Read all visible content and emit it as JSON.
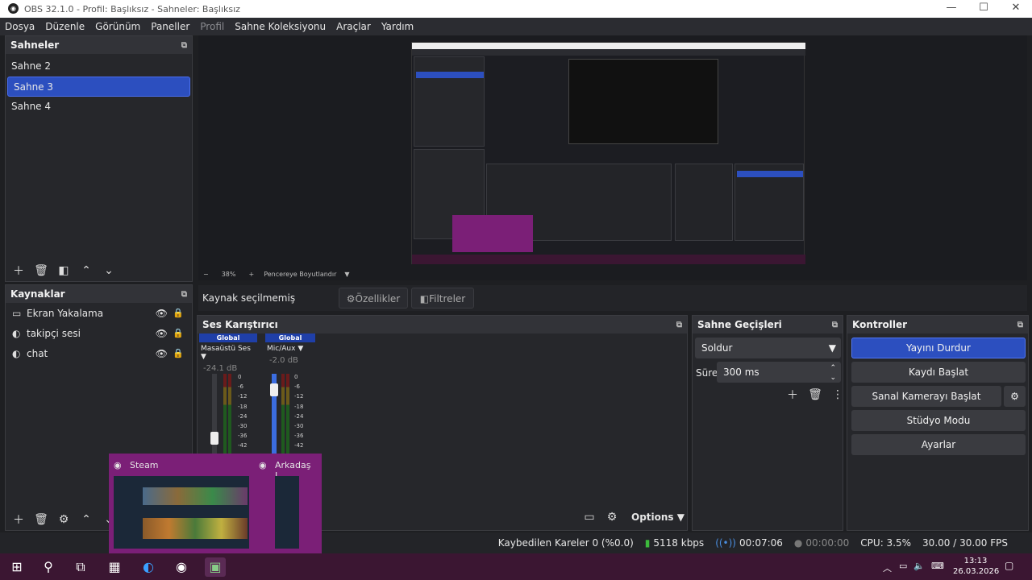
{
  "title": "OBS 32.1.0 - Profil: Başlıksız - Sahneler: Başlıksız",
  "menu": [
    "Dosya",
    "Düzenle",
    "Görünüm",
    "Paneller",
    "Profil",
    "Sahne Koleksiyonu",
    "Araçlar",
    "Yardım"
  ],
  "scenes": {
    "title": "Sahneler",
    "items": [
      "Sahne 2",
      "Sahne 3",
      "Sahne 4"
    ],
    "selected": 1
  },
  "sources": {
    "title": "Kaynaklar",
    "items": [
      {
        "label": "Ekran Yakalama",
        "icon": "monitor-icon"
      },
      {
        "label": "takipçi sesi",
        "icon": "browser-icon"
      },
      {
        "label": "chat",
        "icon": "browser-icon"
      }
    ]
  },
  "preview": {
    "zoom": "38%",
    "fit": "Pencereye Boyutlandır"
  },
  "context": {
    "no_source": "Kaynak seçilmemiş",
    "properties": "Özellikler",
    "filters": "Filtreler"
  },
  "mixer": {
    "title": "Ses Karıştırıcı",
    "channels": [
      {
        "tag": "Global",
        "name": "Masaüstü Ses",
        "db": "-24.1 dB",
        "fader": 0.2
      },
      {
        "tag": "Global",
        "name": "Mic/Aux",
        "db": "-2.0 dB",
        "fader": 0.85
      }
    ],
    "scale": [
      "0",
      "-6",
      "-12",
      "-18",
      "-24",
      "-30",
      "-36",
      "-42"
    ],
    "options": "Options"
  },
  "transitions": {
    "title": "Sahne Geçişleri",
    "type": "Soldur",
    "duration_label": "Süre",
    "duration": "300 ms"
  },
  "controls": {
    "title": "Kontroller",
    "stream": "Yayını Durdur",
    "record": "Kaydı Başlat",
    "vcam": "Sanal Kamerayı Başlat",
    "studio": "Stüdyo Modu",
    "settings": "Ayarlar"
  },
  "status": {
    "dropped": "Kaybedilen Kareler 0 (%0.0)",
    "bitrate": "5118 kbps",
    "stream_time": "00:07:06",
    "rec_time": "00:00:00",
    "cpu": "CPU: 3.5%",
    "fps": "30.00 / 30.00 FPS"
  },
  "taskbar": {
    "time": "13:13",
    "date": "26.03.2026"
  },
  "thumbs": {
    "steam": "Steam",
    "friends": "Arkadaş L..."
  },
  "colors": {
    "accent": "#2c4fbf",
    "taskbar": "#3b1632",
    "thumbs": "#7b1f77"
  }
}
